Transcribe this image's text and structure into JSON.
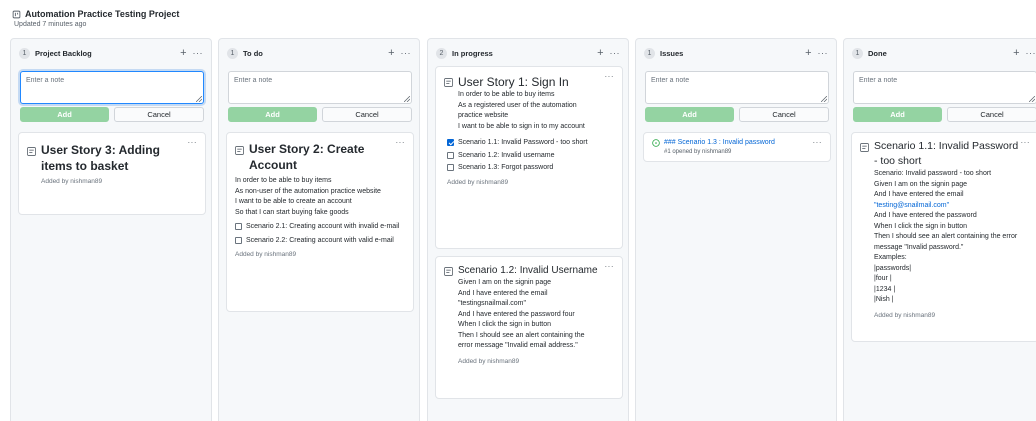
{
  "project": {
    "title": "Automation Practice Testing Project",
    "updated": "Updated 7 minutes ago"
  },
  "common": {
    "placeholder": "Enter a note",
    "add_label": "Add",
    "cancel_label": "Cancel"
  },
  "columns": [
    {
      "count": "1",
      "title": "Project Backlog",
      "card": {
        "title": "User Story 3: Adding items to basket",
        "added": "Added by nishman89"
      }
    },
    {
      "count": "1",
      "title": "To do",
      "card": {
        "title": "User Story 2: Create Account",
        "lines": [
          "In order to be able to buy items",
          "As non-user of the automation practice website",
          "I want to be able to create an account",
          "So that I can start buying fake goods"
        ],
        "tasks": [
          {
            "label": "Scenario 2.1: Creating account with invalid e-mail",
            "checked": false
          },
          {
            "label": "Scenario 2.2: Creating account with valid e-mail",
            "checked": false
          }
        ],
        "added": "Added by nishman89"
      }
    },
    {
      "count": "2",
      "title": "In progress",
      "card1": {
        "title": "User Story 1: Sign In",
        "lines": [
          "In order to be able to buy items",
          "As a registered user of the automation practice website",
          "I want to be able to sign in to my account"
        ],
        "tasks": [
          {
            "label": "Scenario 1.1: Invalid Password - too short",
            "checked": true
          },
          {
            "label": "Scenario 1.2: Invalid username",
            "checked": false
          },
          {
            "label": "Scenario 1.3: Forgot password",
            "checked": false
          }
        ],
        "added": "Added by nishman89"
      },
      "card2": {
        "title": "Scenario 1.2: Invalid Username",
        "lines": [
          "Given I am on the signin page",
          "And I have entered the email \"testingsnailmail.com\"",
          "And I have entered the password four",
          "When I click the sign in button",
          "Then I should see an alert containing the error message \"Invalid email address.\""
        ],
        "added": "Added by nishman89"
      }
    },
    {
      "count": "1",
      "title": "Issues",
      "issue": {
        "title": "### Scenario 1.3 : Invalid password",
        "sub": "#1 opened by nishman89"
      }
    },
    {
      "count": "1",
      "title": "Done",
      "card": {
        "title": "Scenario 1.1: Invalid Password - too short",
        "lines_before": [
          "Scenario: Invalid password - too short",
          "Given I am on the signin page",
          "And I have entered the email"
        ],
        "email": "\"testing@snailmail.com\"",
        "lines_after": [
          "And I have entered the password",
          "When I click the sign in button",
          "Then I should see an alert containing the error message \"Invalid password.\"",
          "Examples:",
          "|passwords|",
          "|four |",
          "|1234 |",
          "|Nish |"
        ],
        "added": "Added by nishman89"
      }
    }
  ]
}
